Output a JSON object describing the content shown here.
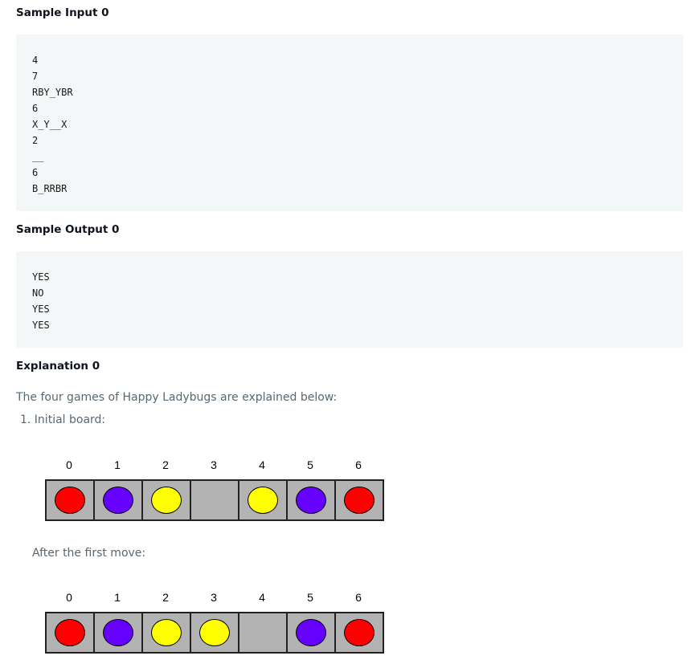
{
  "sample_input": {
    "heading": "Sample Input 0",
    "lines": [
      "4",
      "7",
      "RBY_YBR",
      "6",
      "X_Y__X",
      "2",
      "__",
      "6",
      "B_RRBR"
    ]
  },
  "sample_output": {
    "heading": "Sample Output 0",
    "lines": [
      "YES",
      "NO",
      "YES",
      "YES"
    ]
  },
  "explanation": {
    "heading": "Explanation 0",
    "intro": "The four games of Happy Ladybugs are explained below:",
    "item1": "1. Initial board:",
    "after_first_move": "After the first move:"
  },
  "boards": {
    "indices": [
      "0",
      "1",
      "2",
      "3",
      "4",
      "5",
      "6"
    ],
    "initial": [
      "R",
      "B",
      "Y",
      "_",
      "Y",
      "B",
      "R"
    ],
    "after_first_move": [
      "R",
      "B",
      "Y",
      "Y",
      "_",
      "B",
      "R"
    ]
  },
  "colors": {
    "R": "#ff0000",
    "B": "#6600ff",
    "Y": "#ffff00",
    "_": null
  }
}
